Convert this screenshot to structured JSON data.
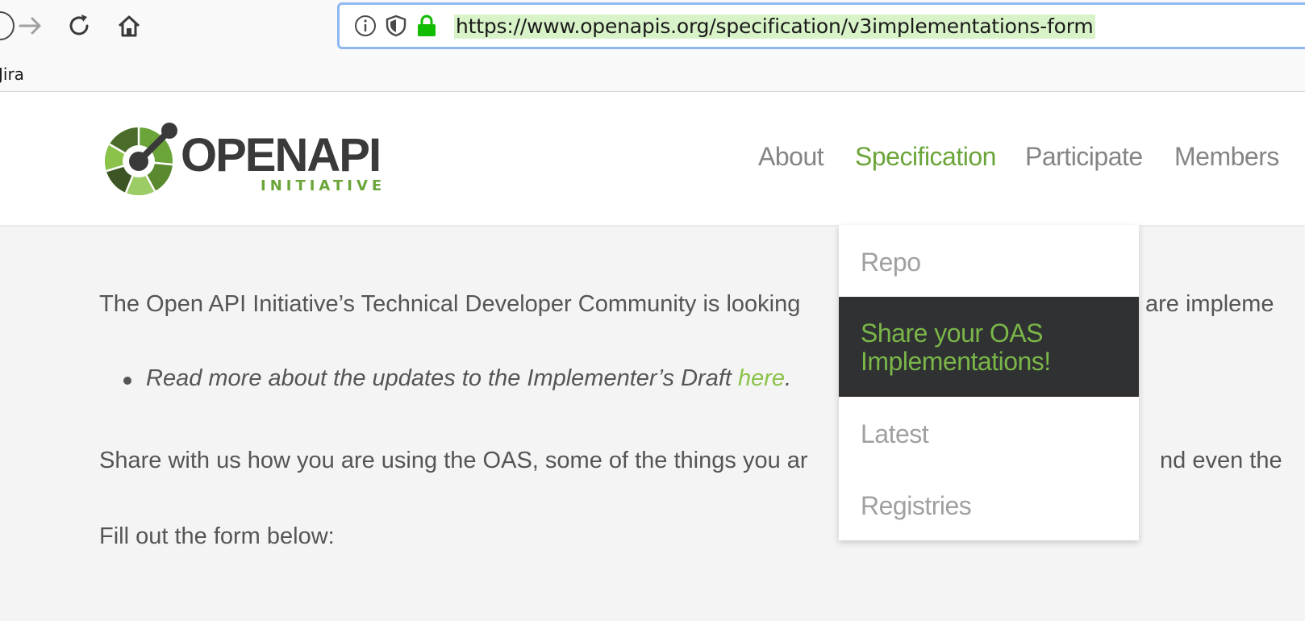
{
  "browser": {
    "url": "https://www.openapis.org/specification/v3implementations-form",
    "bookmarks": [
      "Jira"
    ]
  },
  "site": {
    "logo_text": "OPENAPI",
    "logo_subtext": "INITIATIVE",
    "nav": [
      "About",
      "Specification",
      "Participate",
      "Members"
    ],
    "active_nav": "Specification",
    "dropdown": [
      "Repo",
      "Share your OAS Implementations!",
      "Latest",
      "Registries"
    ],
    "dropdown_active": "Share your OAS Implementations!"
  },
  "content": {
    "p1": "The Open API Initiative’s Technical Developer Community is looking",
    "p1_tail": "are impleme",
    "bullet_text": "Read more about the updates to the Implementer’s Draft ",
    "bullet_link": "here",
    "bullet_end": ".",
    "p3": "Share with us how you are using the OAS, some of the things you ar",
    "p3_tail": "nd even the",
    "p4": "Fill out the form below:"
  },
  "colors": {
    "brand_green": "#6ba539",
    "link_green": "#8bc34a",
    "dropdown_active_bg": "#2f3133",
    "url_highlight": "#d9f3c9"
  }
}
